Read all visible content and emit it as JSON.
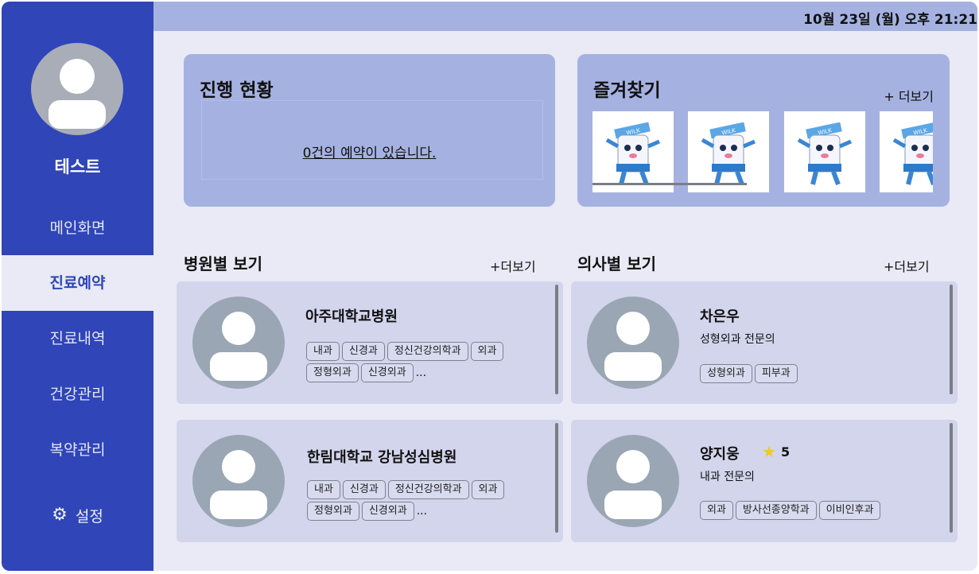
{
  "clock": "10월 23일 (월) 오후 21:21",
  "user": {
    "name": "테스트"
  },
  "nav": [
    {
      "label": "메인화면"
    },
    {
      "label": "진료예약"
    },
    {
      "label": "진료내역"
    },
    {
      "label": "건강관리"
    },
    {
      "label": "복약관리"
    }
  ],
  "settings": {
    "label": "설정",
    "icon": "gear-icon"
  },
  "progress": {
    "title": "진행 현황",
    "message": "0건의 예약이 있습니다."
  },
  "favorites": {
    "title": "즐겨찾기",
    "more": "+ 더보기",
    "mascot_text": "WILK"
  },
  "hospitals": {
    "title": "병원별 보기",
    "more": "+더보기",
    "items": [
      {
        "name": "아주대학교병원",
        "tags": [
          "내과",
          "신경과",
          "정신건강의학과",
          "외과",
          "정형외과",
          "신경외과"
        ],
        "ellipsis": "..."
      },
      {
        "name": "한림대학교 강남성심병원",
        "tags": [
          "내과",
          "신경과",
          "정신건강의학과",
          "외과",
          "정형외과",
          "신경외과"
        ],
        "ellipsis": "..."
      }
    ]
  },
  "doctors": {
    "title": "의사별 보기",
    "more": "+더보기",
    "items": [
      {
        "name": "차은우",
        "specialty": "성형외과 전문의",
        "tags": [
          "성형외과",
          "피부과"
        ]
      },
      {
        "name": "양지웅",
        "rating": "5",
        "specialty": "내과 전문의",
        "tags": [
          "외과",
          "방사선종양학과",
          "이비인후과"
        ]
      }
    ]
  },
  "colors": {
    "sidebar": "#2f45b8",
    "panel": "#a5b2e1",
    "card": "#d2d5ec",
    "background": "#e9eaf6",
    "star": "#f2c72d"
  }
}
